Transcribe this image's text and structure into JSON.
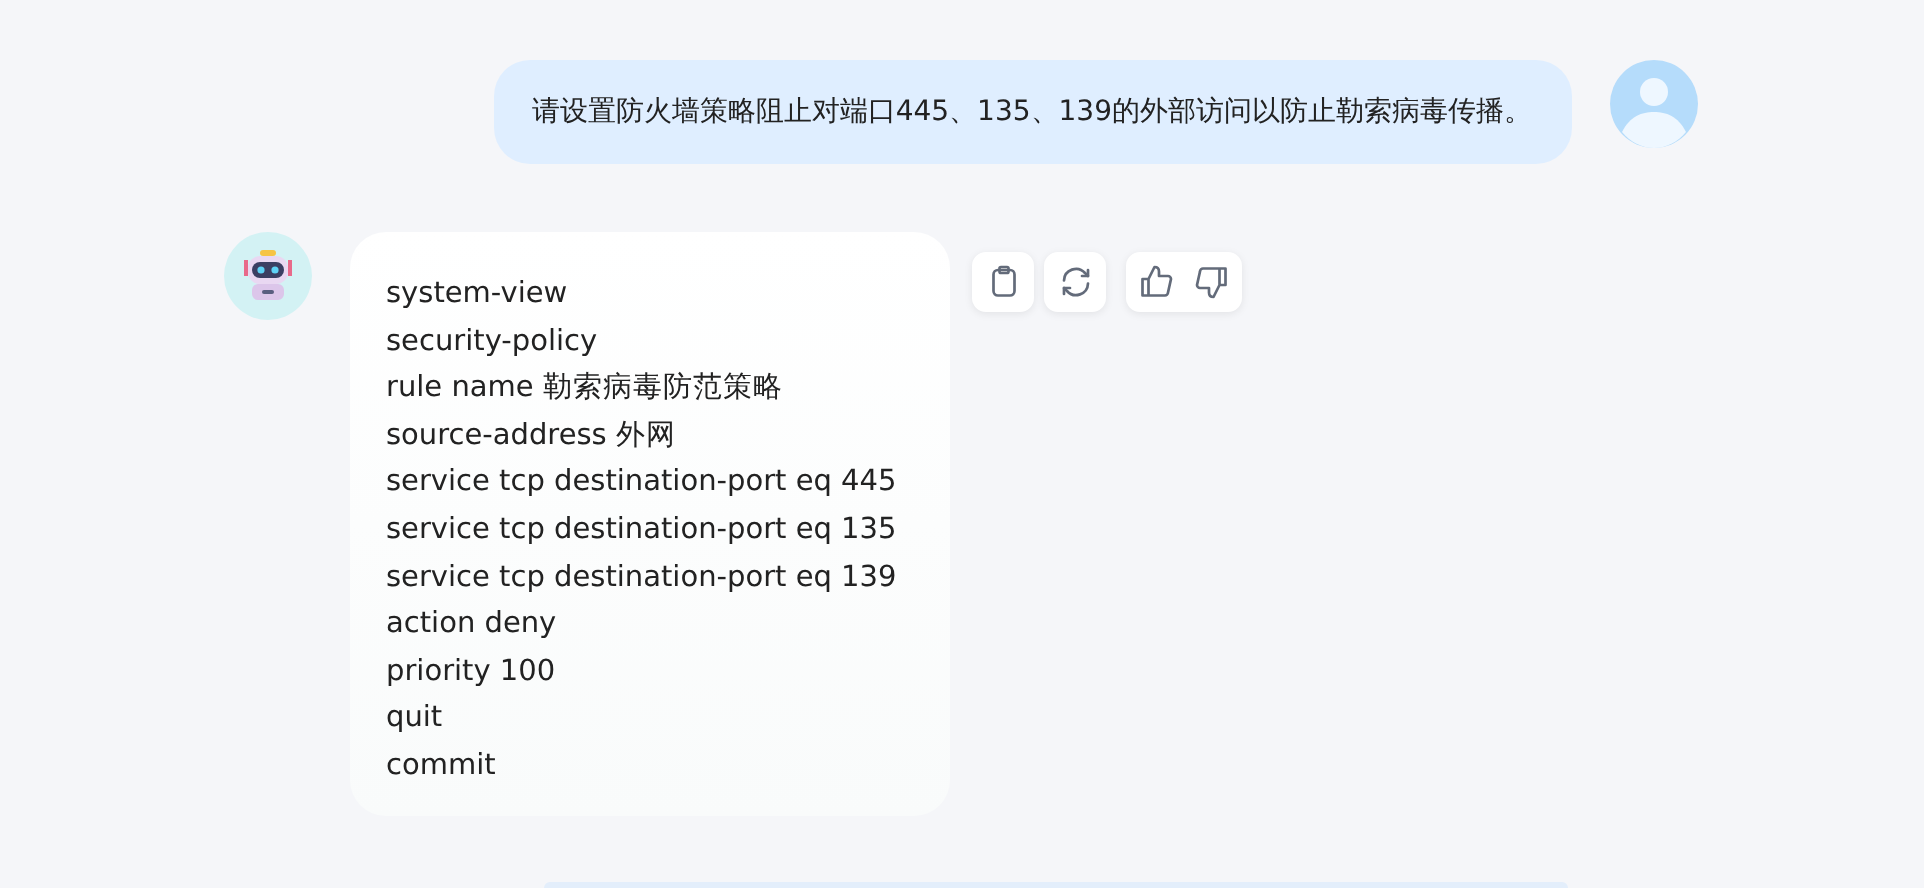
{
  "messages": [
    {
      "kind": "user",
      "text": "请设置防火墙策略阻止对端口445、135、139的外部访问以防止勒索病毒传播。"
    },
    {
      "kind": "bot",
      "lines": [
        "system-view",
        "security-policy",
        "rule name 勒索病毒防范策略",
        "source-address 外网",
        "service tcp destination-port eq 445",
        "service tcp destination-port eq 135",
        "service tcp destination-port eq 139",
        "action deny",
        "priority 100",
        "quit",
        "commit"
      ]
    }
  ]
}
